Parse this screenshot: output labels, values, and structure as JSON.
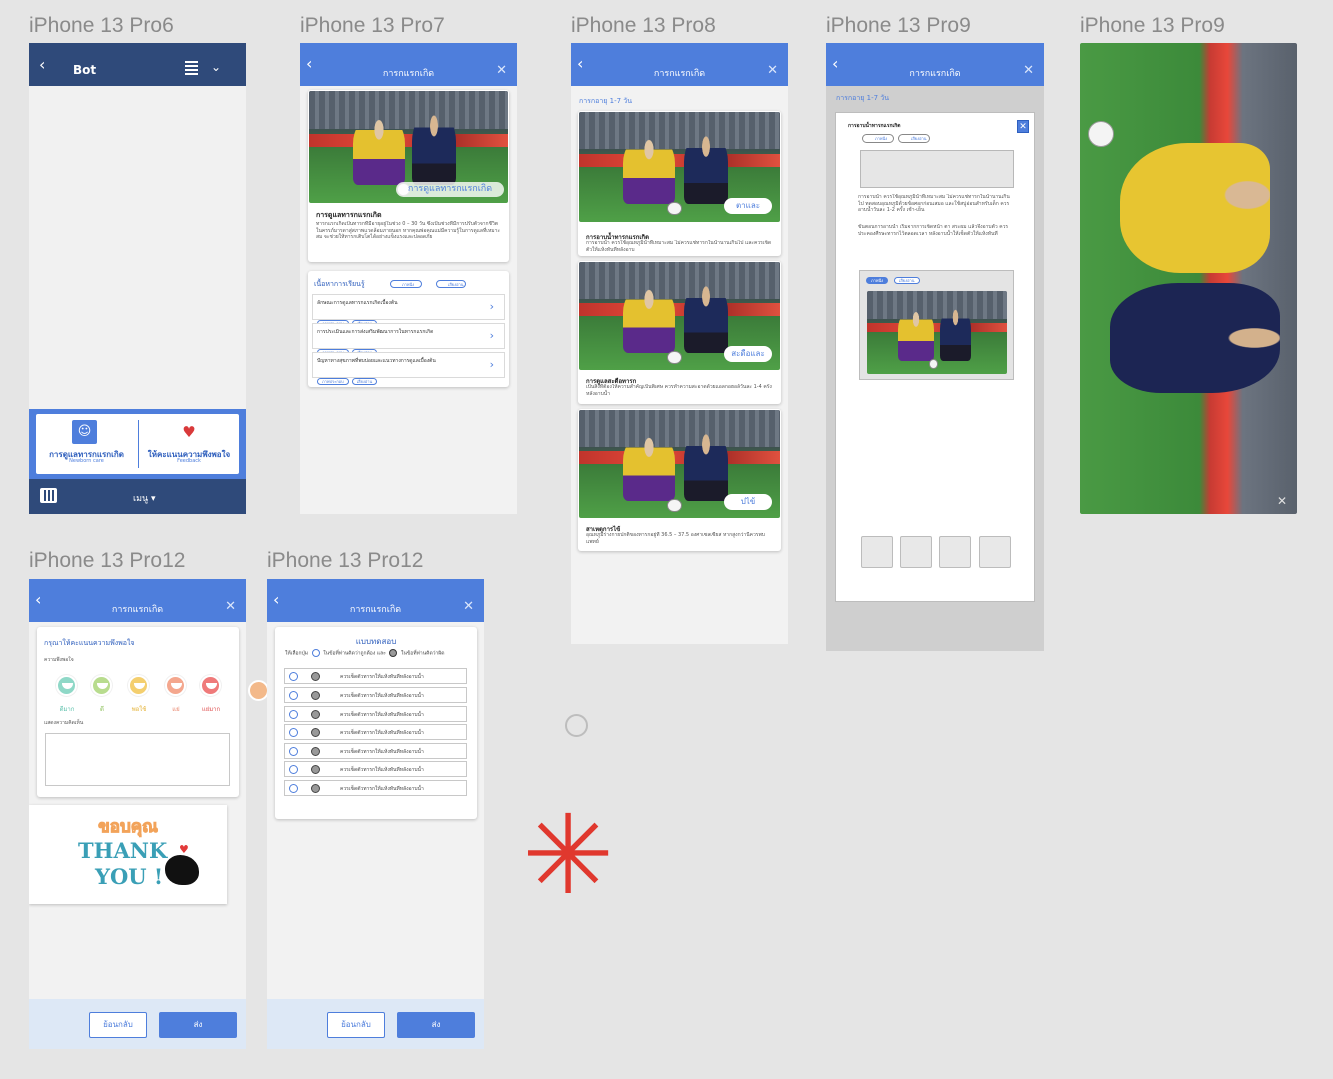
{
  "frame_titles": [
    "iPhone 13 Pro6",
    "iPhone 13 Pro7",
    "iPhone 13 Pro8",
    "iPhone 13 Pro9",
    "iPhone 13 Pro9",
    "iPhone 13 Pro12",
    "iPhone 13 Pro12"
  ],
  "colors": {
    "primary": "#4e7edc",
    "navy": "#2f4a7a",
    "canvas": "#e5e5e5",
    "asterisk": "#e0382e"
  },
  "f1": {
    "header_title": "Bot",
    "menu_card": {
      "left_label": "การดูแลทารกแรกเกิด",
      "left_sub": "Newborn care",
      "right_label": "ให้คะแนนความพึงพอใจ",
      "right_sub": "Feedback"
    },
    "menu_label": "เมนู ▾"
  },
  "f2": {
    "header_title": "การกแรกเกิด",
    "hero_button": "การดูแลทารกแรกเกิด",
    "intro_title": "การดูแลทารกแรกเกิด",
    "intro_text": "ทารกแรกเกิดเป็นทารกที่มีอายุอยู่ในช่วง 0 – 30 วัน ซึ่งเป็นช่วงที่มีการปรับตัวจากชีวิตในครรภ์มารดาสู่สภาพแวดล้อมภายนอก หากคุณพ่อคุณแม่มีความรู้ในการดูแลที่เหมาะสม จะช่วยให้ทารกเติบโตได้อย่างแข็งแรงและปลอดภัย",
    "section_title": "เนื้อหาการเรียนรู้",
    "toggle_1": "ภาพนิ่ง",
    "toggle_2": "เสียงอ่าน",
    "items": [
      {
        "title": "ลักษณะการดูแลทารกแรกเกิดเบื้องต้น",
        "tag1": "ภาพประกอบ",
        "tag2": "เสียงอ่าน"
      },
      {
        "title": "การประเมินและการส่งเสริมพัฒนาการในทารกแรกเกิด",
        "tag1": "ภาพประกอบ",
        "tag2": "เสียงอ่าน"
      },
      {
        "title": "ปัญหาทางสุขภาพที่พบบ่อยและแนวทางการดูแลเบื้องต้น",
        "tag1": "ภาพประกอบ",
        "tag2": "เสียงอ่าน"
      }
    ]
  },
  "f3": {
    "header_title": "การกแรกเกิด",
    "subtitle": "การกอายุ 1-7 วัน",
    "cards": [
      {
        "btn": "ตาและ",
        "title": "การอาบน้ำทารกแรกเกิด",
        "text": "การอาบน้ำ ควรใช้อุณหภูมิน้ำที่เหมาะสม ไม่ควรแช่ทารกในน้ำนานเกินไป และควรเช็ดตัวให้แห้งทันทีหลังอาบ"
      },
      {
        "btn": "สะดือและ",
        "title": "การดูแลสะดือทารก",
        "text": "เป็นสิ่งที่ต้องให้ความสำคัญเป็นพิเศษ ควรทำความสะอาดด้วยแอลกอฮอล์วันละ 1-4 ครั้ง หลังอาบน้ำ"
      },
      {
        "btn": "ปไข้",
        "title": "สาเหตุการไข้",
        "text": "อุณหภูมิร่างกายปกติของทารกอยู่ที่ 36.5 – 37.5 องศาเซลเซียส หากสูงกว่านี้ควรพบแพทย์"
      }
    ]
  },
  "f4": {
    "header_title": "การกแรกเกิด",
    "subtitle": "การกอายุ 1-7 วัน",
    "popup_title": "การอาบน้ำทารกแรกเกิด",
    "audio_1": "ภาพนิ่ง",
    "audio_2": "เสียงอ่าน",
    "paragraph_1": "การอาบน้ำ ควรใช้อุณหภูมิน้ำที่เหมาะสม ไม่ควรแช่ทารกในน้ำนานเกินไป ทดสอบอุณหภูมิด้วยข้อศอกก่อนเสมอ และใช้สบู่อ่อนสำหรับเด็ก ควรอาบน้ำวันละ 1-2 ครั้ง เช้า-เย็น",
    "paragraph_2": "ขั้นตอนการอาบน้ำ เริ่มจากการเช็ดหน้า ตา สระผม แล้วจึงอาบตัว ควรประคองศีรษะทารกไว้ตลอดเวลา หลังอาบน้ำให้เช็ดตัวให้แห้งทันที",
    "tab_1": "ภาพนิ่ง",
    "tab_2": "เสียงอ่าน"
  },
  "f6": {
    "header_title": "การกแรกเกิด",
    "card_title": "กรุณาให้คะแนนความพึงพอใจ",
    "satisfaction_label": "ความพึงพอใจ",
    "faces": [
      {
        "label": "ดีมาก",
        "color": "#8fd8c7"
      },
      {
        "label": "ดี",
        "color": "#b8dc8e"
      },
      {
        "label": "พอใช้",
        "color": "#f4cf6f"
      },
      {
        "label": "แย่",
        "color": "#f4a78e"
      },
      {
        "label": "แย่มาก",
        "color": "#ef7a7a"
      }
    ],
    "comment_label": "แสดงความคิดเห็น",
    "thanks_thai": "ขอบคุณ",
    "thanks_1": "THANK",
    "thanks_2": "YOU !",
    "back_button": "ย้อนกลับ",
    "send_button": "ส่ง"
  },
  "f7": {
    "header_title": "การกแรกเกิด",
    "card_title": "แบบทดสอบ",
    "instruction": "ให้เลือกปุ่ม",
    "legend_1": "ในข้อที่ท่านคิดว่าถูกต้อง และ",
    "legend_2": "ในข้อที่ท่านคิดว่าผิด",
    "questions": [
      "ควรเช็ดตัวทารกให้แห้งทันทีหลังอาบน้ำ",
      "ควรเช็ดตัวทารกให้แห้งทันทีหลังอาบน้ำ",
      "ควรเช็ดตัวทารกให้แห้งทันทีหลังอาบน้ำ",
      "ควรเช็ดตัวทารกให้แห้งทันทีหลังอาบน้ำ",
      "ควรเช็ดตัวทารกให้แห้งทันทีหลังอาบน้ำ",
      "ควรเช็ดตัวทารกให้แห้งทันทีหลังอาบน้ำ",
      "ควรเช็ดตัวทารกให้แห้งทันทีหลังอาบน้ำ"
    ],
    "back_button": "ย้อนกลับ",
    "send_button": "ส่ง"
  }
}
